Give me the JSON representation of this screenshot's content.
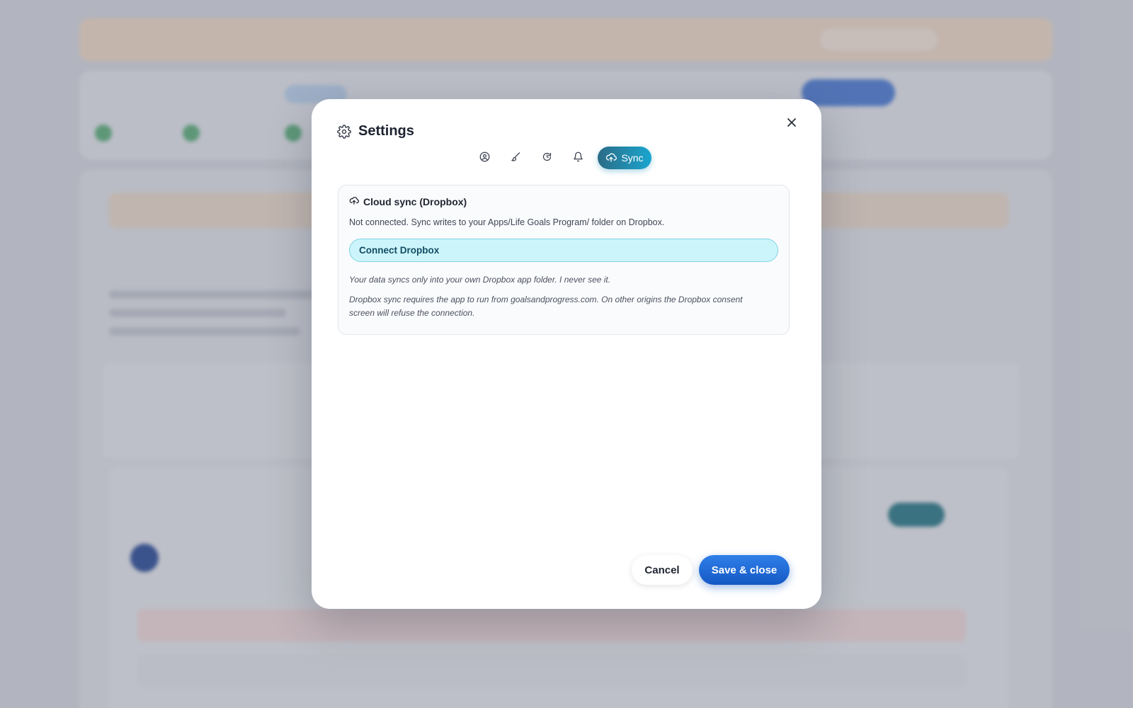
{
  "modal": {
    "title": "Settings",
    "close_icon": "close-icon",
    "tabs": [
      {
        "icon": "user-circle-icon",
        "label": ""
      },
      {
        "icon": "brush-icon",
        "label": ""
      },
      {
        "icon": "refresh-icon",
        "label": ""
      },
      {
        "icon": "bell-icon",
        "label": ""
      },
      {
        "icon": "cloud-upload-icon",
        "label": "Sync",
        "active": true
      }
    ],
    "sync": {
      "heading": "Cloud sync (Dropbox)",
      "description": "Not connected. Sync writes to your Apps/Life Goals Program/ folder on Dropbox.",
      "connect_label": "Connect Dropbox",
      "note_privacy": "Your data syncs only into your own Dropbox app folder. I never see it.",
      "note_origin": "Dropbox sync requires the app to run from goalsandprogress.com. On other origins the Dropbox consent screen will refuse the connection."
    },
    "cancel_label": "Cancel",
    "save_label": "Save & close"
  },
  "colors": {
    "accent": "#1558c4",
    "sync_tab": "#1aa6cf",
    "connect_bg": "#ccf5fb"
  }
}
